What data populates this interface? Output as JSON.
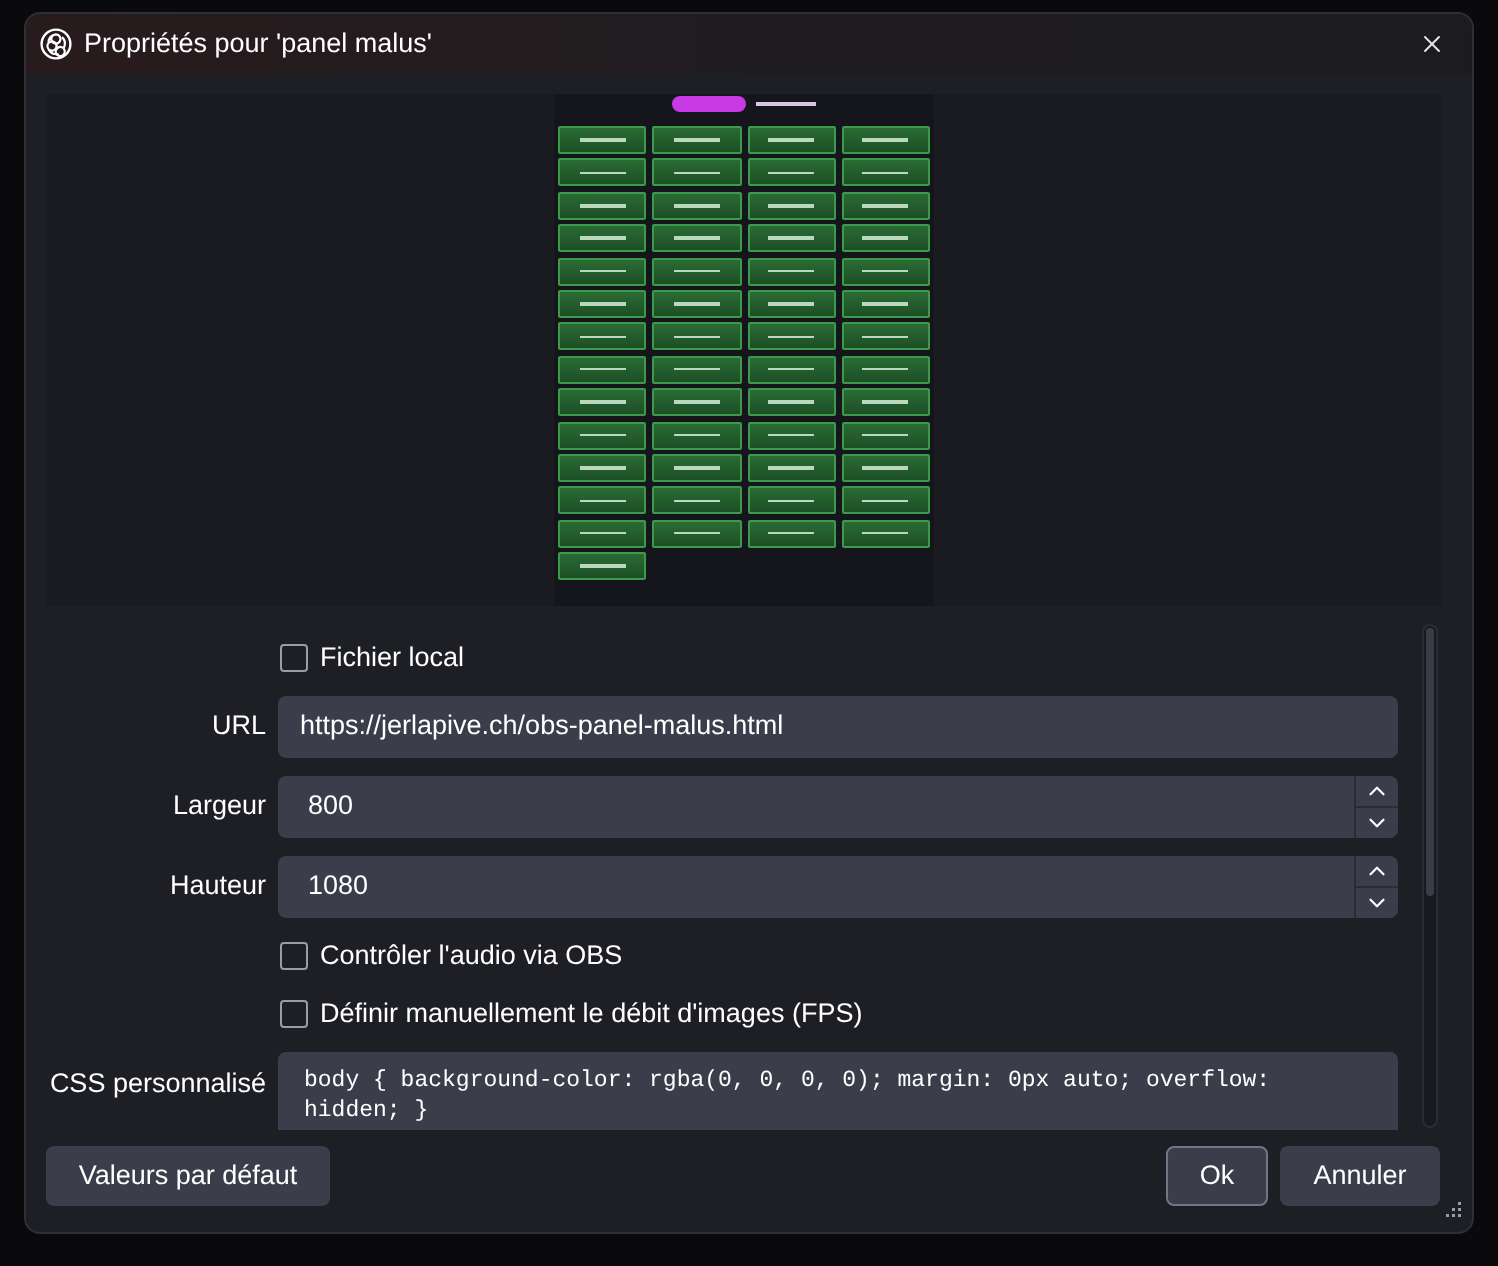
{
  "window": {
    "title": "Propriétés pour 'panel malus'"
  },
  "properties": [
    {
      "kind": "checkbox",
      "label": "Fichier local",
      "checked": false
    },
    {
      "kind": "text",
      "label": "URL",
      "value": "https://jerlapive.ch/obs-panel-malus.html"
    },
    {
      "kind": "number",
      "label": "Largeur",
      "value": "800"
    },
    {
      "kind": "number",
      "label": "Hauteur",
      "value": "1080"
    },
    {
      "kind": "checkbox",
      "label": "Contrôler l'audio via OBS",
      "checked": false
    },
    {
      "kind": "checkbox",
      "label": "Définir manuellement le débit d'images (FPS)",
      "checked": false
    },
    {
      "kind": "textarea",
      "label": "CSS personnalisé",
      "value": "body { background-color: rgba(0, 0, 0, 0); margin: 0px auto; overflow: hidden; }"
    }
  ],
  "footer": {
    "reset": {
      "label": "Valeurs par défaut",
      "default": false
    },
    "actions": [
      {
        "label": "Ok",
        "default": true
      },
      {
        "label": "Annuler",
        "default": false
      }
    ]
  }
}
